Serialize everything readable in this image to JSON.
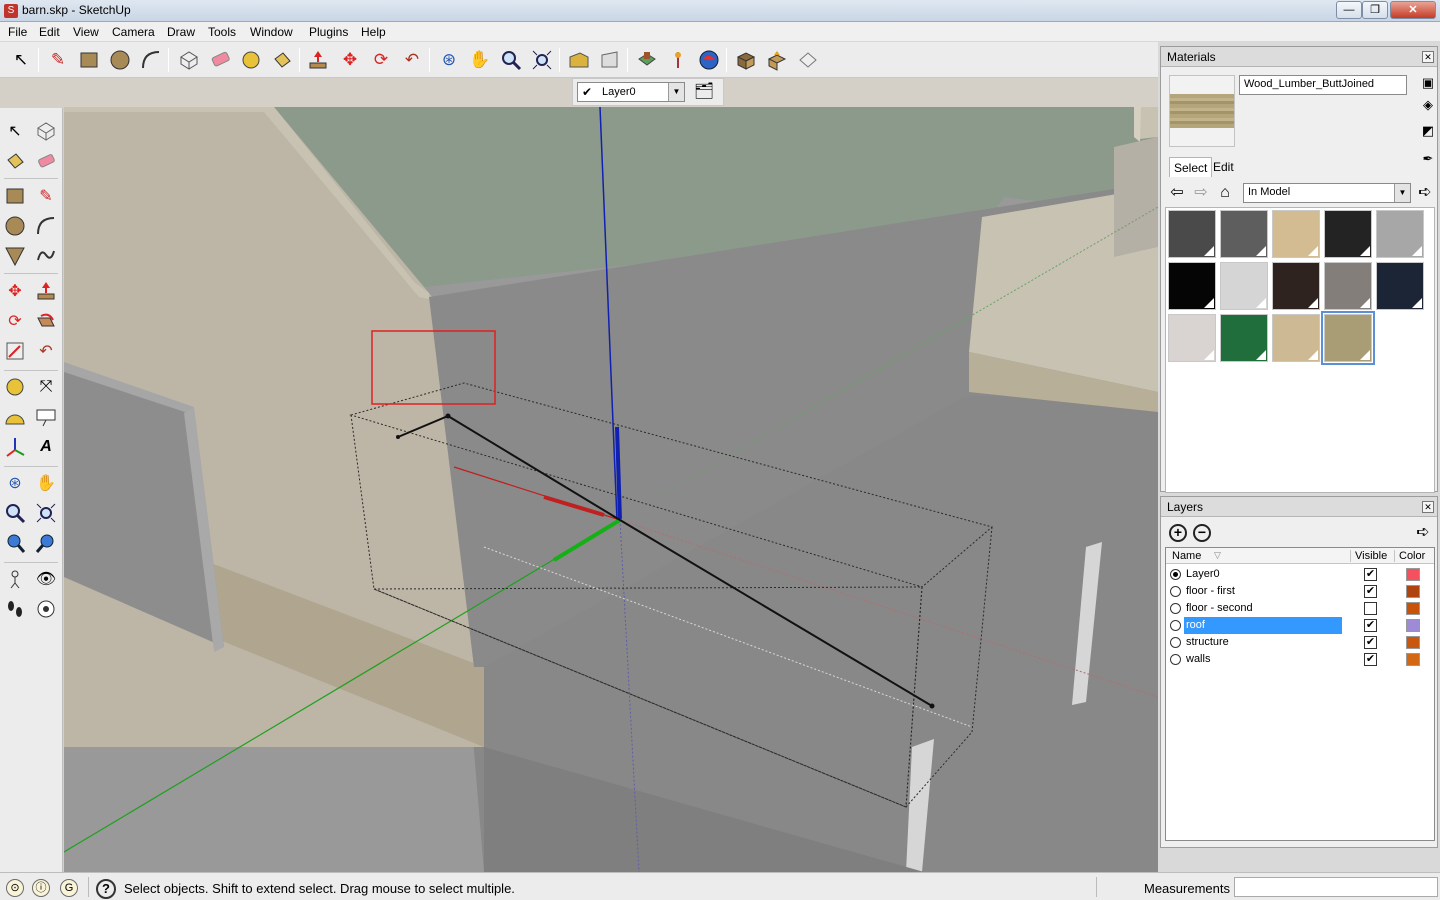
{
  "window": {
    "title": "barn.skp - SketchUp",
    "min": "—",
    "max": "❐",
    "close": "✕"
  },
  "menu": [
    "File",
    "Edit",
    "View",
    "Camera",
    "Draw",
    "Tools",
    "Window",
    "Plugins",
    "Help"
  ],
  "layer_toolbar": {
    "current_layer": "Layer0"
  },
  "materials": {
    "title": "Materials",
    "current_name": "Wood_Lumber_ButtJoined",
    "tabs": [
      "Select",
      "Edit"
    ],
    "collection": "In Model",
    "swatches": [
      {
        "color": "#4a4a4a"
      },
      {
        "color": "#5e5e5e"
      },
      {
        "color": "#d3bb92"
      },
      {
        "color": "#232323"
      },
      {
        "color": "#a7a7a7"
      },
      {
        "color": "#050505"
      },
      {
        "color": "#d5d5d5"
      },
      {
        "color": "#2f2320"
      },
      {
        "color": "#847e7a"
      },
      {
        "color": "#1c2536"
      },
      {
        "color": "#d9d4d2"
      },
      {
        "color": "#1f6e3c"
      },
      {
        "color": "#cdb994"
      },
      {
        "color": "#a89d74",
        "selected": true
      }
    ]
  },
  "layers": {
    "title": "Layers",
    "columns": {
      "name": "Name",
      "visible": "Visible",
      "color": "Color"
    },
    "rows": [
      {
        "name": "Layer0",
        "current": true,
        "visible": true,
        "color": "#f4505e"
      },
      {
        "name": "floor - first",
        "current": false,
        "visible": true,
        "color": "#b0440f"
      },
      {
        "name": "floor - second",
        "current": false,
        "visible": false,
        "color": "#c9520a"
      },
      {
        "name": "roof",
        "current": false,
        "visible": true,
        "color": "#9d8bd6",
        "selected": true
      },
      {
        "name": "structure",
        "current": false,
        "visible": true,
        "color": "#c85810"
      },
      {
        "name": "walls",
        "current": false,
        "visible": true,
        "color": "#d26814"
      }
    ]
  },
  "status": {
    "text": "Select objects. Shift to extend select. Drag mouse to select multiple.",
    "measurements_label": "Measurements",
    "help_glyph": "?"
  },
  "toolbar_icons": [
    "select-icon",
    "pencil-icon",
    "rectangle-icon",
    "circle-icon",
    "arc-icon",
    "make-component-icon",
    "eraser-icon",
    "tape-measure-icon",
    "paint-bucket-icon",
    "push-pull-icon",
    "move-icon",
    "rotate-icon",
    "follow-me-icon",
    "orbit-icon",
    "pan-icon",
    "zoom-icon",
    "zoom-extents-icon",
    "3d-warehouse-icon",
    "share-model-icon",
    "get-photo-texture-icon",
    "place-model-icon",
    "google-earth-icon",
    "get-models-icon",
    "share-icon",
    "component-icon"
  ]
}
